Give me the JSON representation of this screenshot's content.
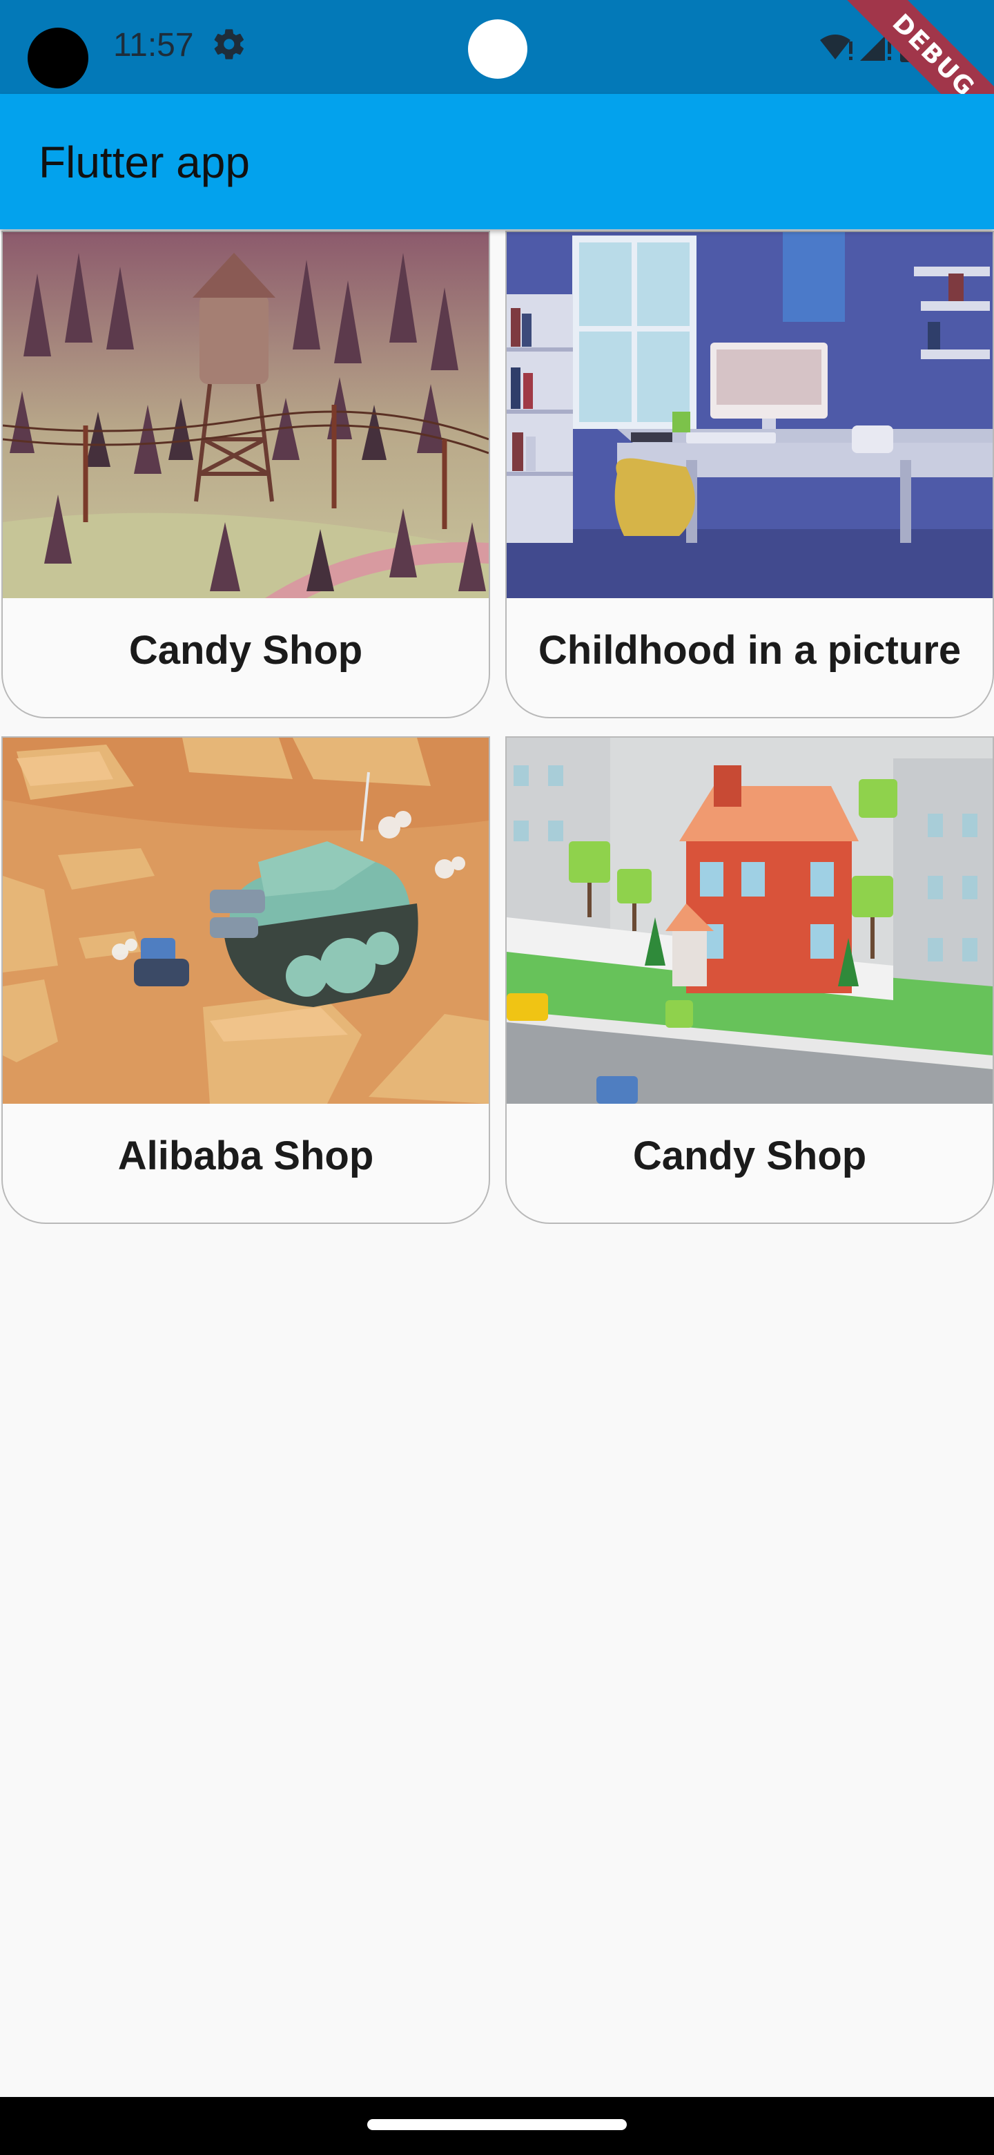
{
  "status_bar": {
    "time": "11:57",
    "icons": [
      "settings-gear-icon",
      "wifi-alert-icon",
      "signal-alert-icon",
      "battery-icon"
    ],
    "debug_banner": "DEBUG"
  },
  "app_bar": {
    "title": "Flutter app",
    "color": "#03a2ed"
  },
  "cards": [
    {
      "label": "Candy Shop",
      "image": "low-poly-forest-water-tower-image"
    },
    {
      "label": "Childhood in a picture",
      "image": "low-poly-bedroom-desk-image"
    },
    {
      "label": "Alibaba Shop",
      "image": "low-poly-desert-tank-image"
    },
    {
      "label": "Candy Shop",
      "image": "low-poly-red-house-street-image"
    }
  ],
  "colors": {
    "status_bar": "#0379b8",
    "app_bar": "#03a2ed",
    "background": "#f9f9f9",
    "debug_banner": "#a1364a"
  }
}
